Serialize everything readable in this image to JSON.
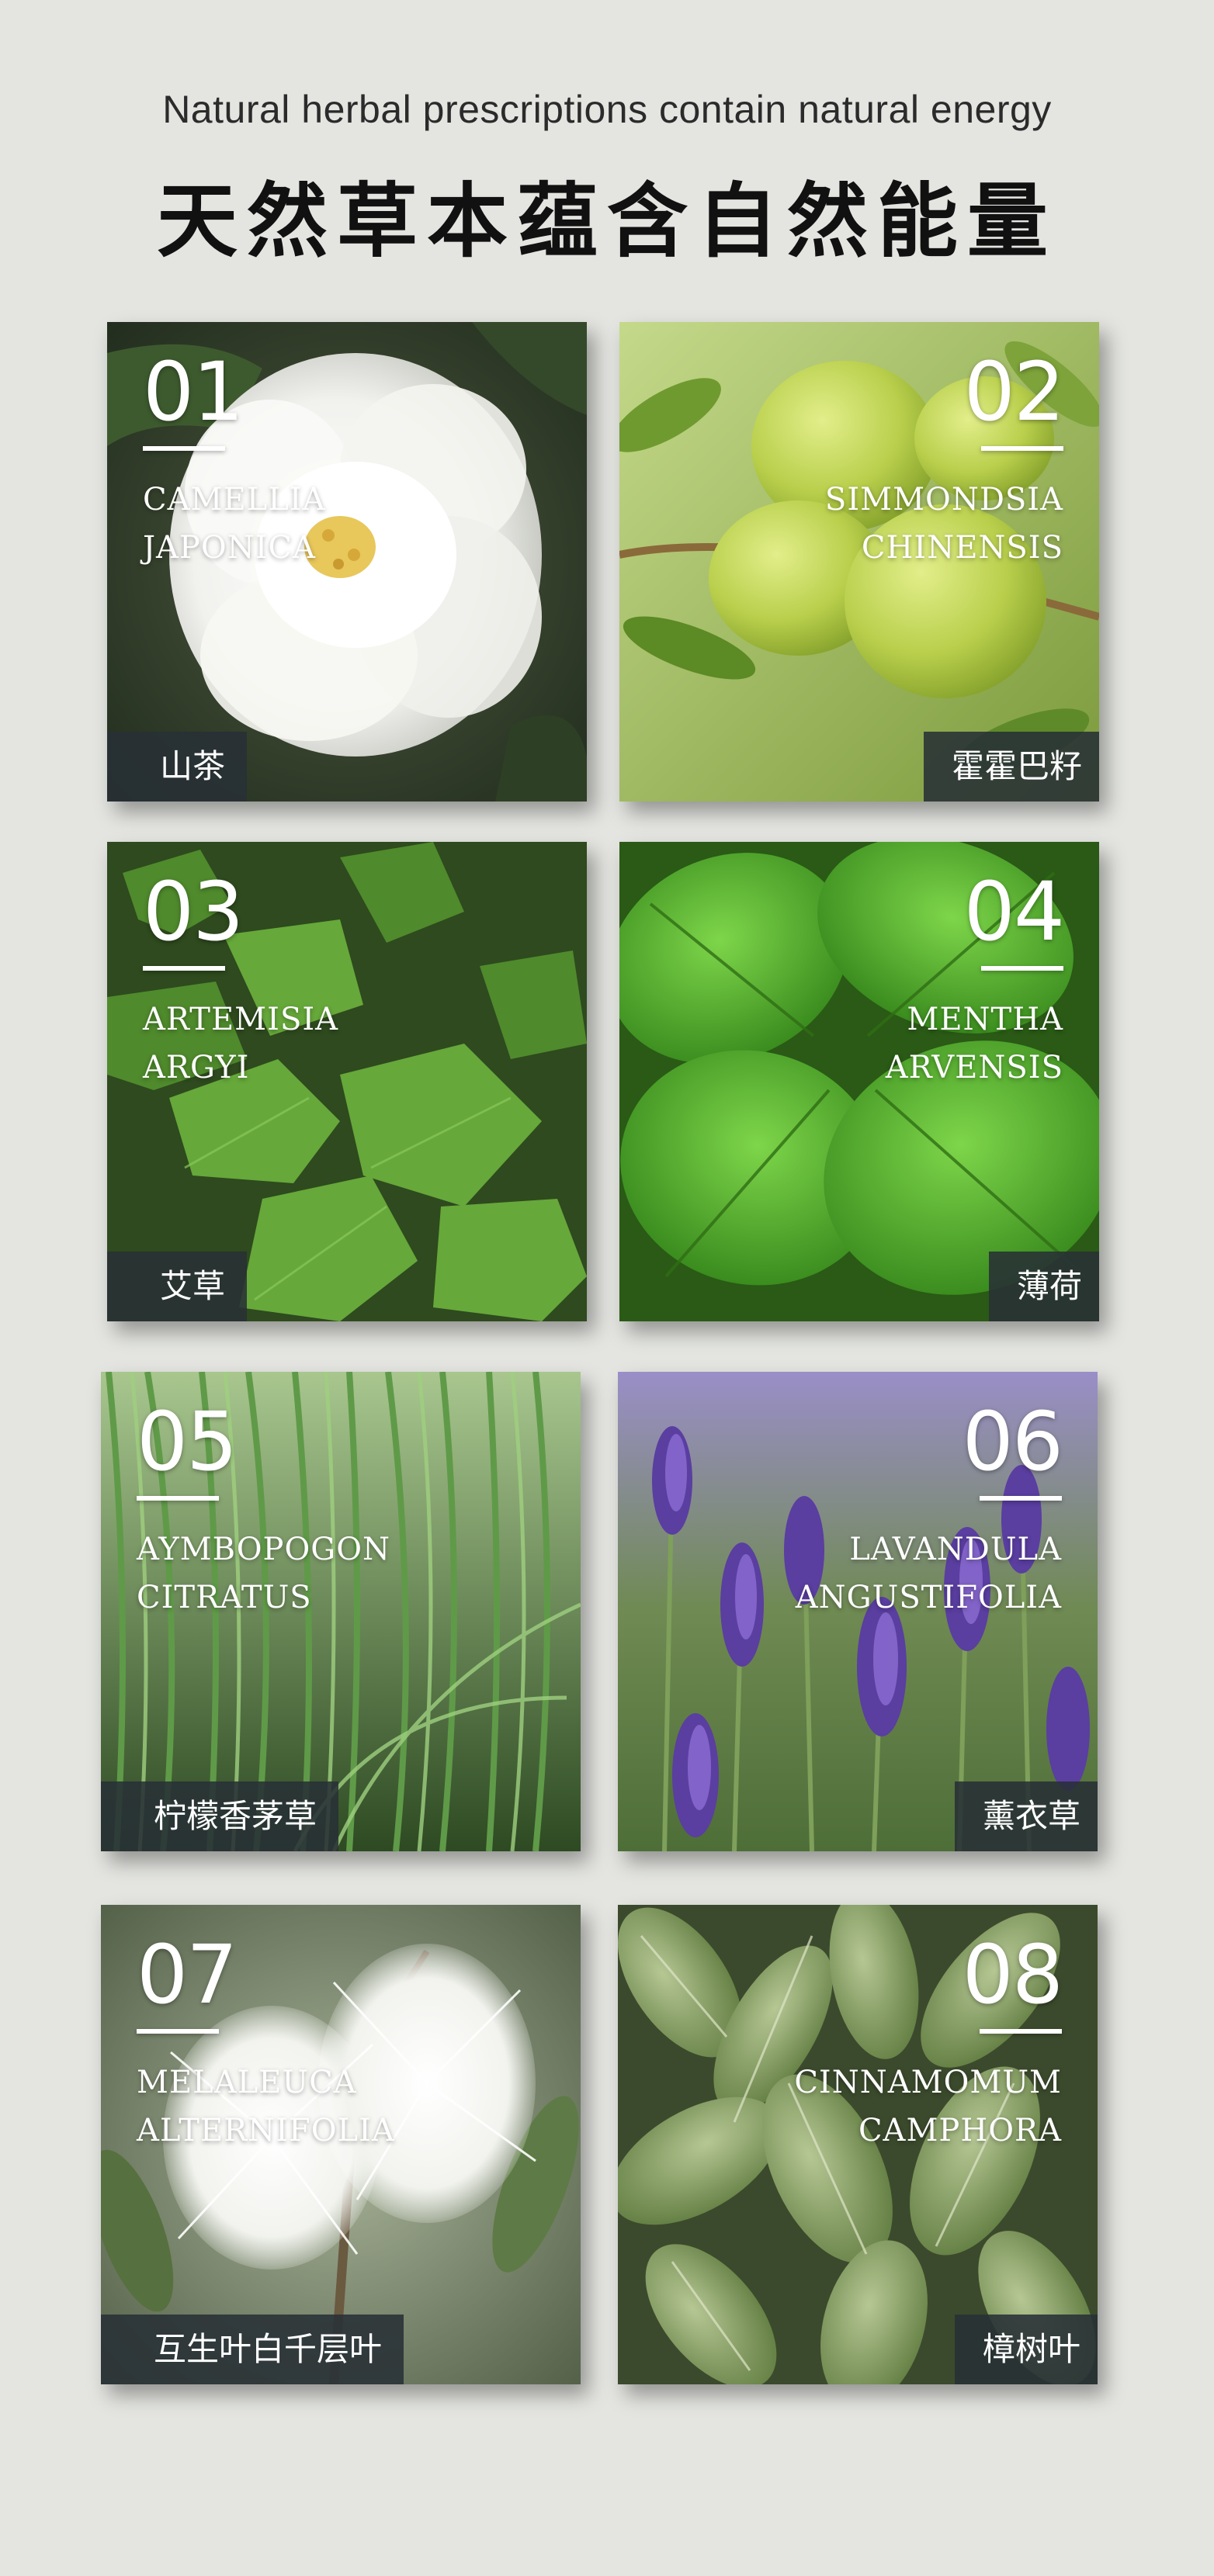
{
  "header": {
    "subtitle_en": "Natural herbal prescriptions contain natural energy",
    "title_cn": "天然草本蕴含自然能量"
  },
  "herbs": [
    {
      "number": "01",
      "latin_line1": "CAMELLIA",
      "latin_line2": "JAPONICA",
      "name_cn": "山茶",
      "photo_icon": "white-camellia-flower-photo"
    },
    {
      "number": "02",
      "latin_line1": "SIMMONDSIA",
      "latin_line2": "CHINENSIS",
      "name_cn": "霍霍巴籽",
      "photo_icon": "jojoba-fruit-photo"
    },
    {
      "number": "03",
      "latin_line1": "ARTEMISIA",
      "latin_line2": "ARGYI",
      "name_cn": "艾草",
      "photo_icon": "mugwort-leaves-photo"
    },
    {
      "number": "04",
      "latin_line1": "MENTHA",
      "latin_line2": "ARVENSIS",
      "name_cn": "薄荷",
      "photo_icon": "mint-leaves-photo"
    },
    {
      "number": "05",
      "latin_line1": "AYMBOPOGON",
      "latin_line2": "CITRATUS",
      "name_cn": "柠檬香茅草",
      "photo_icon": "lemongrass-photo"
    },
    {
      "number": "06",
      "latin_line1": "LAVANDULA",
      "latin_line2": "ANGUSTIFOLIA",
      "name_cn": "薰衣草",
      "photo_icon": "lavender-photo"
    },
    {
      "number": "07",
      "latin_line1": "MELALEUCA",
      "latin_line2": "ALTERNIFOLIA",
      "name_cn": "互生叶白千层叶",
      "photo_icon": "tea-tree-blossom-photo"
    },
    {
      "number": "08",
      "latin_line1": "CINNAMOMUM",
      "latin_line2": "CAMPHORA",
      "name_cn": "樟树叶",
      "photo_icon": "camphor-leaves-photo"
    }
  ],
  "colors": {
    "page_background": "#e4e5e1",
    "label_background": "#283036",
    "text_light": "#ffffff",
    "title_text": "#111111"
  }
}
